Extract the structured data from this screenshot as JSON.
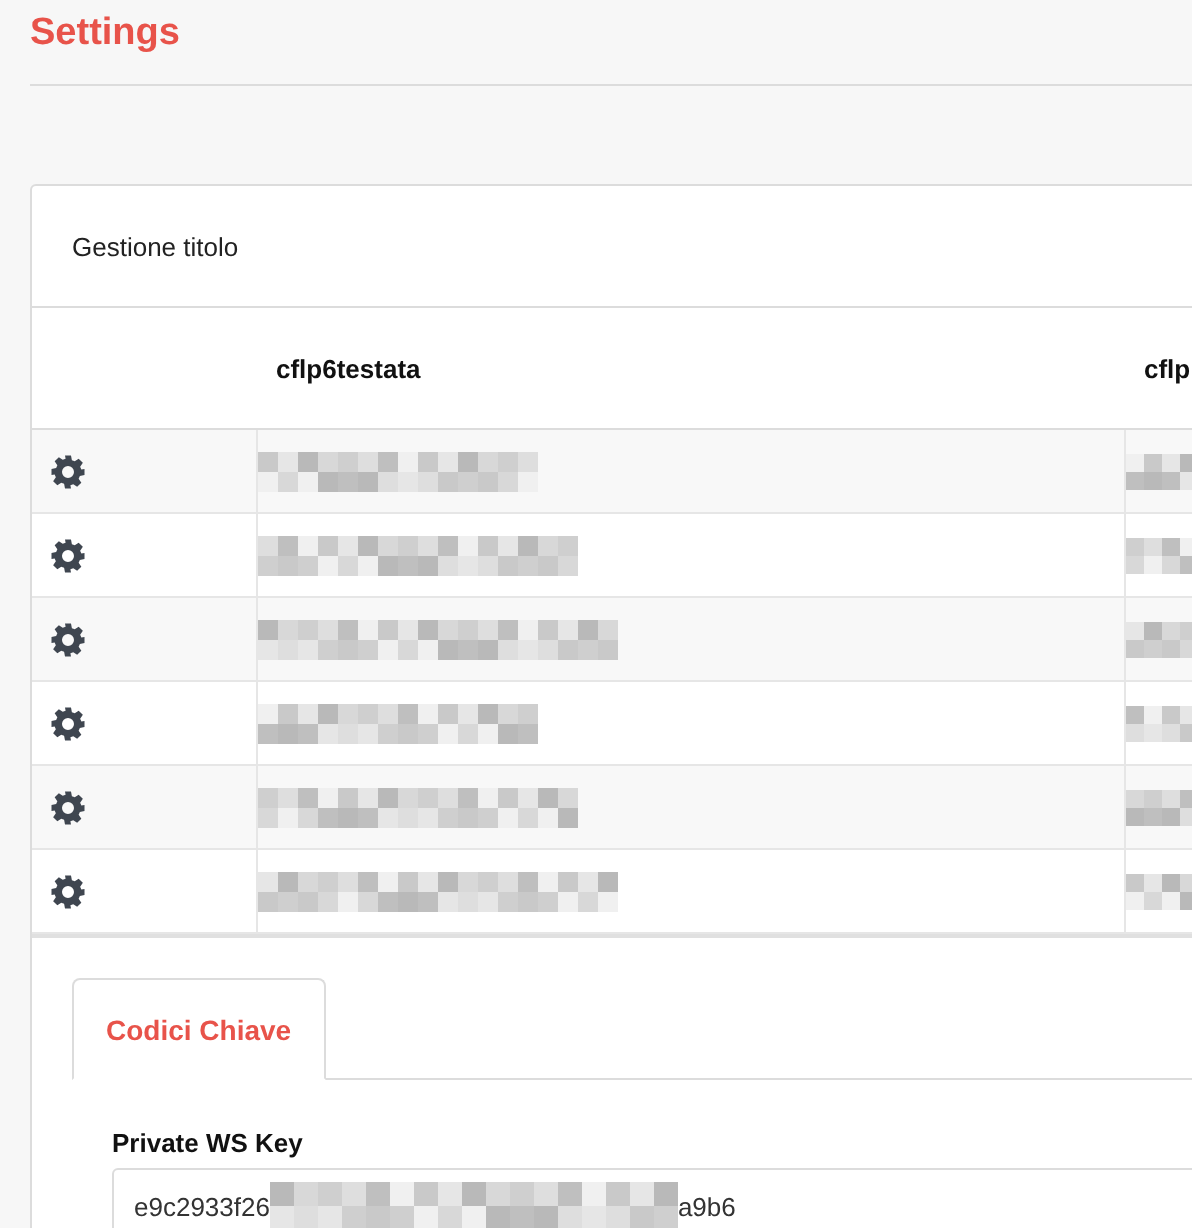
{
  "page": {
    "title": "Settings"
  },
  "card": {
    "title": "Gestione titolo"
  },
  "table": {
    "columns": [
      "cflp6testata",
      "cflp"
    ],
    "rows": [
      {
        "cells": [
          {
            "redacted": true
          },
          {
            "redacted": true
          }
        ]
      },
      {
        "cells": [
          {
            "redacted": true
          },
          {
            "redacted": true
          }
        ]
      },
      {
        "cells": [
          {
            "redacted": true
          },
          {
            "redacted": true
          }
        ]
      },
      {
        "cells": [
          {
            "redacted": true
          },
          {
            "redacted": true
          }
        ]
      },
      {
        "cells": [
          {
            "redacted": true
          },
          {
            "redacted": true
          }
        ]
      },
      {
        "cells": [
          {
            "redacted": true
          },
          {
            "redacted": true
          }
        ]
      }
    ]
  },
  "tabs": [
    {
      "label": "Codici Chiave",
      "selected": true
    }
  ],
  "key_field": {
    "label": "Private WS Key",
    "value_start": "e9c2933f26",
    "redacted": true,
    "value_end": "a9b6"
  }
}
